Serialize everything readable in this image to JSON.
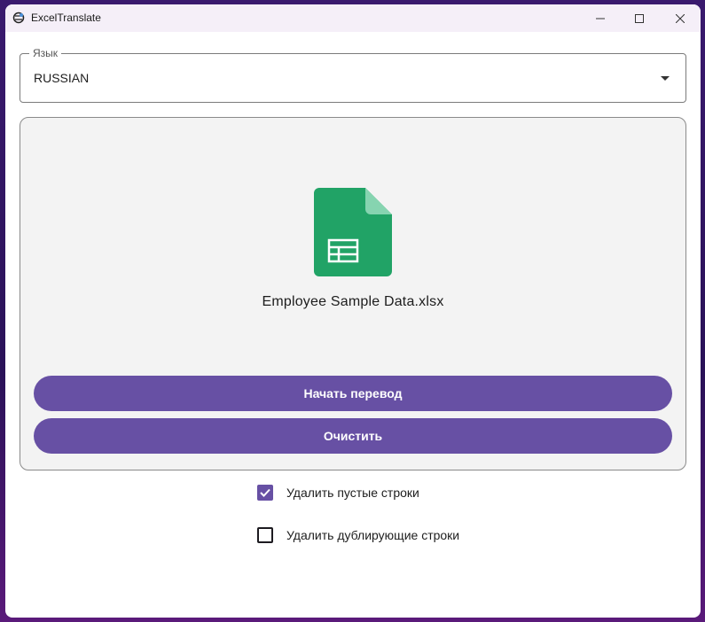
{
  "window": {
    "title": "ExcelTranslate"
  },
  "language": {
    "label": "Язык",
    "value": "RUSSIAN"
  },
  "drop_zone": {
    "file_icon": "excel-file-icon",
    "file_name": "Employee Sample Data.xlsx",
    "start_button": "Начать перевод",
    "clear_button": "Очистить"
  },
  "options": [
    {
      "label": "Удалить пустые строки",
      "checked": true
    },
    {
      "label": "Удалить дублирующие строки",
      "checked": false
    }
  ],
  "colors": {
    "accent": "#6750a4",
    "excel_green": "#21a366",
    "excel_fold": "#86d4b0"
  }
}
